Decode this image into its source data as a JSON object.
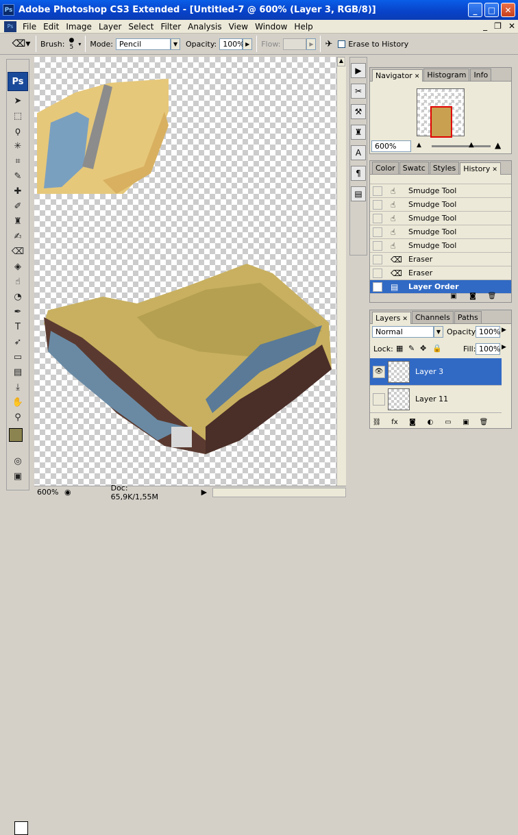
{
  "window": {
    "title": "Adobe Photoshop CS3 Extended - [Untitled-7 @ 600% (Layer 3, RGB/8)]",
    "app_icon": "Ps"
  },
  "menu": [
    "File",
    "Edit",
    "Image",
    "Layer",
    "Select",
    "Filter",
    "Analysis",
    "View",
    "Window",
    "Help"
  ],
  "options": {
    "brush_label": "Brush:",
    "brush_size": "5",
    "mode_label": "Mode:",
    "mode_value": "Pencil",
    "opacity_label": "Opacity:",
    "opacity_value": "100%",
    "flow_label": "Flow:",
    "flow_value": "",
    "erase_history_label": "Erase to History"
  },
  "toolbox": {
    "logo": "Ps"
  },
  "status": {
    "zoom": "600%",
    "doc": "Doc: 65,9K/1,55M"
  },
  "navigator": {
    "tabs": [
      "Navigator",
      "Histogram",
      "Info"
    ],
    "zoom": "600%"
  },
  "history": {
    "tabs": [
      "Color",
      "Swatc",
      "Styles",
      "History"
    ],
    "items": [
      "Smudge Tool",
      "Smudge Tool",
      "Smudge Tool",
      "Smudge Tool",
      "Smudge Tool",
      "Eraser",
      "Eraser",
      "Layer Order"
    ]
  },
  "layers": {
    "tabs": [
      "Layers",
      "Channels",
      "Paths"
    ],
    "blend_mode": "Normal",
    "opacity_label": "Opacity:",
    "opacity_value": "100%",
    "lock_label": "Lock:",
    "fill_label": "Fill:",
    "fill_value": "100%",
    "items": [
      {
        "name": "Layer 3",
        "visible": true,
        "selected": true
      },
      {
        "name": "Layer 11",
        "visible": false,
        "selected": false
      }
    ]
  },
  "colors": {
    "accent": "#316ac5",
    "titlebar": "#0a4ed8",
    "foreground": "#8c8450"
  }
}
